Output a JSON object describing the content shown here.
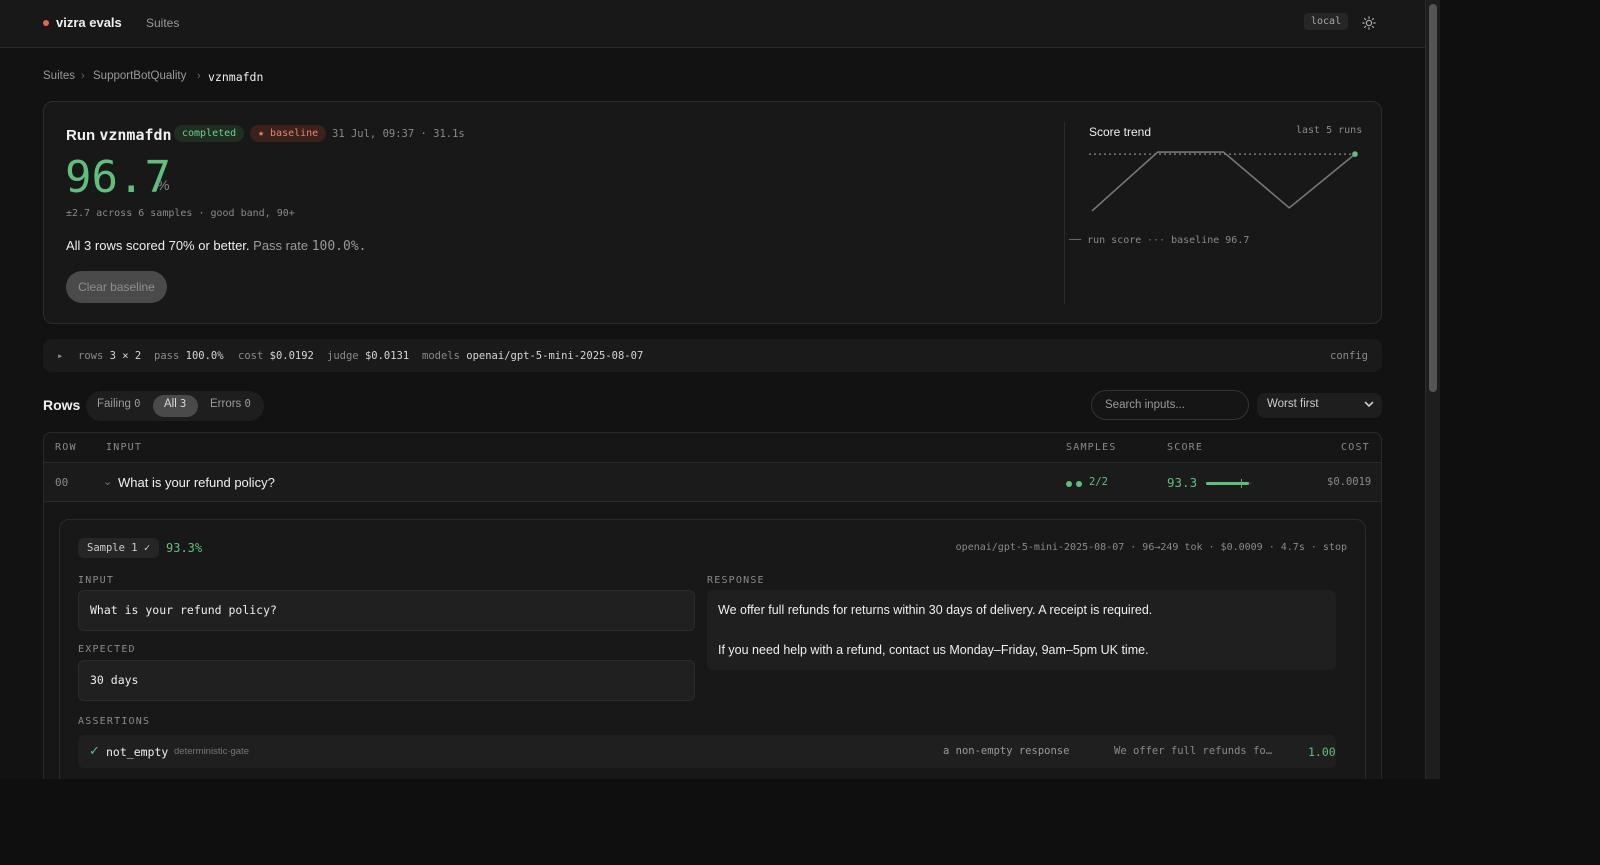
{
  "app": {
    "brand": "vizra evals",
    "nav_suites": "Suites",
    "env": "local"
  },
  "breadcrumb": [
    "Suites",
    "SupportBotQuality",
    "vznmafdn"
  ],
  "run": {
    "title_prefix": "Run",
    "id": "vznmafdn",
    "status": "completed",
    "baseline_tag": "★ baseline",
    "meta": "31 Jul, 09:37 · 31.1s",
    "score": "96.7",
    "score_unit": "%",
    "score_sub": "±2.7 across 6 samples · good band, 90+",
    "summary_main": "All 3 rows scored 70% or better.",
    "summary_pass_label": "Pass rate",
    "summary_pass_value": "100.0%.",
    "clear_baseline": "Clear baseline"
  },
  "trend": {
    "title": "Score trend",
    "subtitle": "last 5 runs",
    "legend_run": "run score",
    "legend_baseline": "baseline 96.7",
    "scores": [
      91.2,
      96.9,
      96.9,
      91.5,
      96.7
    ],
    "baseline": 96.7,
    "min": 91.0,
    "max": 97.0,
    "color_line": "#777777",
    "color_point": "#5fbf7c"
  },
  "stats": {
    "rows_label": "rows",
    "rows_value": "3 × 2",
    "pass_label": "pass",
    "pass_value": "100.0%",
    "cost_label": "cost",
    "cost_value": "$0.0192",
    "judge_label": "judge",
    "judge_value": "$0.0131",
    "models_label": "models",
    "models_value": "openai/gpt-5-mini-2025-08-07",
    "config": "config"
  },
  "rows_header": {
    "title": "Rows",
    "failing": "Failing",
    "failing_count": "0",
    "all": "All",
    "all_count": "3",
    "errors": "Errors",
    "errors_count": "0",
    "search_placeholder": "Search inputs...",
    "sort": "Worst first"
  },
  "table": {
    "headers": {
      "row": "ROW",
      "input": "INPUT",
      "samples": "SAMPLES",
      "score": "SCORE",
      "cost": "COST"
    },
    "rows": [
      {
        "row": "00",
        "caret": "⌄",
        "input": "What is your refund policy?",
        "samples": "2/2",
        "score": "93.3",
        "score_fraction": 0.933,
        "cost": "$0.0019"
      }
    ]
  },
  "sample": {
    "badge": "Sample 1 ✓",
    "score": "93.3%",
    "meta": "openai/gpt-5-mini-2025-08-07 · 96→249 tok · $0.0009 · 4.7s · stop",
    "input_label": "INPUT",
    "input": "What is your refund policy?",
    "expected_label": "EXPECTED",
    "expected": "30 days",
    "response_label": "RESPONSE",
    "response_1": "We offer full refunds for returns within 30 days of delivery. A receipt is required.",
    "response_2": "If you need help with a refund, contact us Monday–Friday, 9am–5pm UK time.",
    "assertions_label": "ASSERTIONS",
    "assertion": {
      "check": "✓",
      "name": "not_empty",
      "kind": "deterministic·gate",
      "expected": "a non-empty response",
      "actual": "We offer full refunds fo…",
      "score": "1.00"
    }
  }
}
